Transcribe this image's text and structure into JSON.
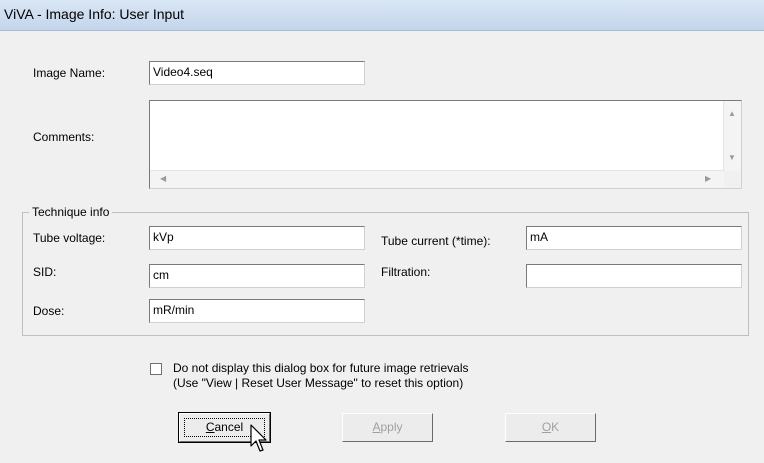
{
  "window": {
    "title": "ViVA - Image Info: User Input"
  },
  "image_name": {
    "label": "Image Name:",
    "value": "Video4.seq"
  },
  "comments": {
    "label": "Comments:",
    "value": ""
  },
  "technique": {
    "title": "Technique info",
    "tube_voltage": {
      "label": "Tube voltage:",
      "value": "kVp"
    },
    "tube_current": {
      "label": "Tube current (*time):",
      "value": "mA"
    },
    "sid": {
      "label": "SID:",
      "value": "cm"
    },
    "filtration": {
      "label": "Filtration:",
      "value": ""
    },
    "dose": {
      "label": "Dose:",
      "value": "mR/min"
    }
  },
  "option": {
    "checked": false,
    "line1": "Do not display this dialog box for future image retrievals",
    "line2": "(Use \"View | Reset User Message\" to reset this option)"
  },
  "buttons": {
    "cancel": {
      "mnemonic": "C",
      "rest": "ancel"
    },
    "apply": {
      "mnemonic": "A",
      "rest": "pply",
      "enabled": false
    },
    "ok": {
      "mnemonic": "O",
      "rest": "K",
      "enabled": false
    }
  },
  "icons": {
    "scroll_up": "triangle-up",
    "scroll_down": "triangle-down",
    "scroll_left": "triangle-left",
    "scroll_right": "triangle-right",
    "cursor": "arrow-pointer"
  }
}
